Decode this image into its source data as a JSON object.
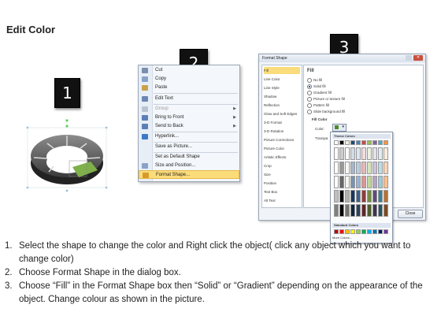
{
  "title": "Edit Color",
  "badges": [
    "1",
    "2",
    "3"
  ],
  "context_menu": {
    "items": [
      {
        "label": "Cut",
        "submenu": false,
        "disabled": false,
        "icon": "scissors-icon",
        "icon_color": "#7a8fb0"
      },
      {
        "label": "Copy",
        "submenu": false,
        "disabled": false,
        "icon": "copy-icon",
        "icon_color": "#8aa2c8"
      },
      {
        "label": "Paste",
        "submenu": false,
        "disabled": false,
        "icon": "paste-icon",
        "icon_color": "#c9a24a"
      },
      {
        "label": "Edit Text",
        "submenu": false,
        "disabled": false,
        "icon": "edit-text-icon",
        "icon_color": "#6b86b5"
      },
      {
        "label": "Group",
        "submenu": true,
        "disabled": true,
        "icon": "group-icon",
        "icon_color": "#b9c3d2"
      },
      {
        "label": "Bring to Front",
        "submenu": true,
        "disabled": false,
        "icon": "bring-to-front-icon",
        "icon_color": "#5b7fb8"
      },
      {
        "label": "Send to Back",
        "submenu": true,
        "disabled": false,
        "icon": "send-to-back-icon",
        "icon_color": "#5b7fb8"
      },
      {
        "label": "Hyperlink...",
        "submenu": false,
        "disabled": false,
        "icon": "hyperlink-icon",
        "icon_color": "#3c79c7"
      },
      {
        "label": "Save as Picture...",
        "submenu": false,
        "disabled": false,
        "icon": "",
        "icon_color": ""
      },
      {
        "label": "Set as Default Shape",
        "submenu": false,
        "disabled": false,
        "icon": "",
        "icon_color": ""
      },
      {
        "label": "Size and Position...",
        "submenu": false,
        "disabled": false,
        "icon": "size-position-icon",
        "icon_color": "#8aa2c8"
      },
      {
        "label": "Format Shape...",
        "submenu": false,
        "disabled": false,
        "highlighted": true,
        "icon": "format-shape-icon",
        "icon_color": "#d89a2a"
      }
    ]
  },
  "dialog": {
    "title": "Format Shape",
    "nav": [
      "Fill",
      "Line Color",
      "Line Style",
      "Shadow",
      "Reflection",
      "Glow and Soft Edges",
      "3-D Format",
      "3-D Rotation",
      "Picture Corrections",
      "Picture Color",
      "Artistic Effects",
      "Crop",
      "Size",
      "Position",
      "Text Box",
      "Alt Text"
    ],
    "fill_header": "Fill",
    "options": [
      "No fill",
      "Solid fill",
      "Gradient fill",
      "Picture or texture fill",
      "Pattern fill",
      "Slide background fill"
    ],
    "selected_option": "Solid fill",
    "fill_color_label": "Fill Color",
    "color_label": "Color:",
    "transparency_label": "Transpa",
    "theme_colors_label": "Theme Colors",
    "standard_colors_label": "Standard Colors",
    "more_colors_label": "More Colors...",
    "close_label": "Close",
    "theme_row": [
      "#ffffff",
      "#000000",
      "#eeece1",
      "#1f497d",
      "#4f81bd",
      "#c0504d",
      "#9bbb59",
      "#8064a2",
      "#4bacc6",
      "#f79646"
    ],
    "standard_row": [
      "#c00000",
      "#ff0000",
      "#ffc000",
      "#ffff00",
      "#92d050",
      "#00b050",
      "#00b0f0",
      "#0070c0",
      "#002060",
      "#7030a0"
    ]
  },
  "instructions": [
    {
      "num": "1.",
      "text": "Select the shape to change the color and Right click the object( click any object which you want to change color)"
    },
    {
      "num": "2.",
      "text": "Choose Format Shape in the dialog box."
    },
    {
      "num": "3.",
      "text": "Choose “Fill” in the Format Shape box then “Solid” or “Gradient” depending on the appearance of the object. Change colour as shown in the picture."
    }
  ]
}
